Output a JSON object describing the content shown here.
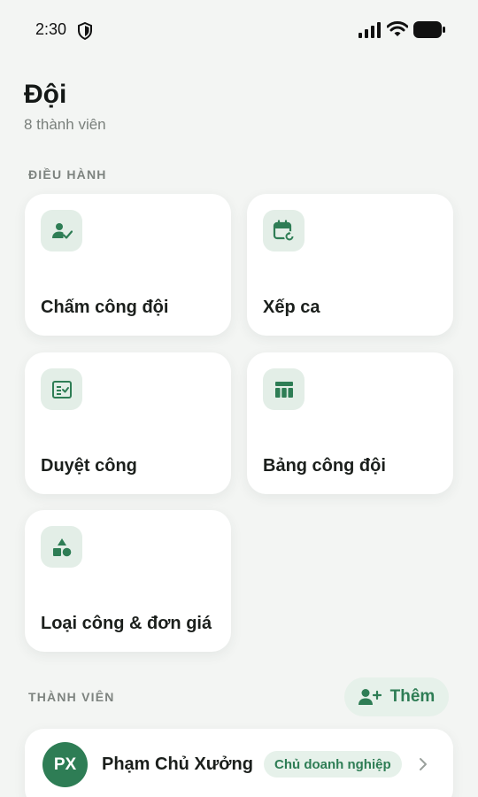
{
  "status_bar": {
    "time": "2:30",
    "icons": [
      "shield-icon",
      "signal-icon",
      "wifi-icon",
      "battery-icon"
    ]
  },
  "header": {
    "title": "Đội",
    "subtitle": "8 thành viên"
  },
  "operations": {
    "section_label": "ĐIỀU HÀNH",
    "tiles": [
      {
        "label": "Chấm công đội",
        "icon": "person-check-icon"
      },
      {
        "label": "Xếp ca",
        "icon": "calendar-refresh-icon"
      },
      {
        "label": "Duyệt công",
        "icon": "checklist-icon"
      },
      {
        "label": "Bảng công đội",
        "icon": "table-icon"
      },
      {
        "label": "Loại công & đơn giá",
        "icon": "shapes-icon"
      }
    ]
  },
  "members": {
    "section_label": "THÀNH VIÊN",
    "add_button_label": "Thêm",
    "list": [
      {
        "initials": "PX",
        "name": "Phạm Chủ Xưởng",
        "role": "Chủ doanh nghiệp"
      }
    ]
  },
  "colors": {
    "accent": "#2E7D55",
    "accent_soft": "#E6F1EA",
    "background": "#F3F5F3",
    "card": "#FFFFFF"
  }
}
